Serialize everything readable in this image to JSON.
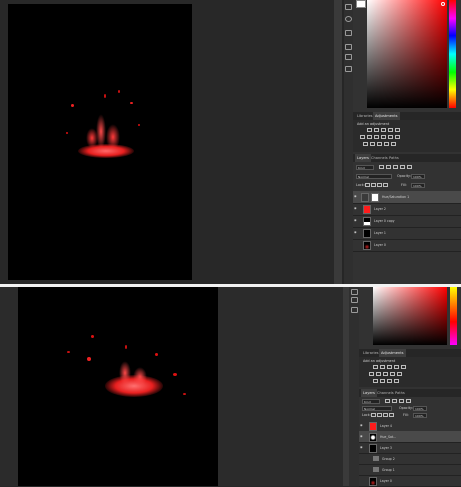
{
  "top": {
    "adjustments": {
      "tabs": [
        "Libraries",
        "Adjustments"
      ],
      "active_tab": "Adjustments",
      "heading": "Add an adjustment"
    },
    "layers_panel": {
      "tabs": [
        "Layers",
        "Channels",
        "Paths"
      ],
      "active_tab": "Layers",
      "kind_label": "Kind",
      "blend_mode": "Normal",
      "opacity_label": "Opacity:",
      "opacity_value": "100%",
      "lock_label": "Lock:",
      "fill_label": "Fill:",
      "fill_value": "100%",
      "layers": [
        {
          "name": "Hue/Saturation 1",
          "thumb": "white",
          "selected": true
        },
        {
          "name": "Layer 2",
          "thumb": "red",
          "selected": false
        },
        {
          "name": "Layer 0 copy",
          "thumb": "mask",
          "selected": false
        },
        {
          "name": "Layer 1",
          "thumb": "black",
          "selected": false
        },
        {
          "name": "Layer 0",
          "thumb": "splash",
          "selected": false
        }
      ]
    }
  },
  "bottom": {
    "adjustments": {
      "tabs": [
        "Libraries",
        "Adjustments"
      ],
      "active_tab": "Adjustments",
      "heading": "Add an adjustment"
    },
    "layers_panel": {
      "tabs": [
        "Layers",
        "Channels",
        "Paths"
      ],
      "active_tab": "Layers",
      "kind_label": "Kind",
      "blend_mode": "Normal",
      "opacity_label": "Opacity:",
      "opacity_value": "100%",
      "lock_label": "Lock:",
      "fill_label": "Fill:",
      "fill_value": "100%",
      "layers": [
        {
          "name": "Layer 4",
          "thumb": "red",
          "selected": false
        },
        {
          "name": "Hue_Sat...",
          "thumb": "mask",
          "selected": true
        },
        {
          "name": "Layer 3",
          "thumb": "black",
          "selected": false
        },
        {
          "name": "Group 2",
          "thumb": "folder",
          "selected": false
        },
        {
          "name": "Group 1",
          "thumb": "folder",
          "selected": false
        },
        {
          "name": "Layer 0",
          "thumb": "splash",
          "selected": false
        }
      ]
    }
  },
  "colors": {
    "workspace": "#282828",
    "panel": "#323232",
    "accent_red": "#ff2a2a",
    "document": "#000000"
  }
}
